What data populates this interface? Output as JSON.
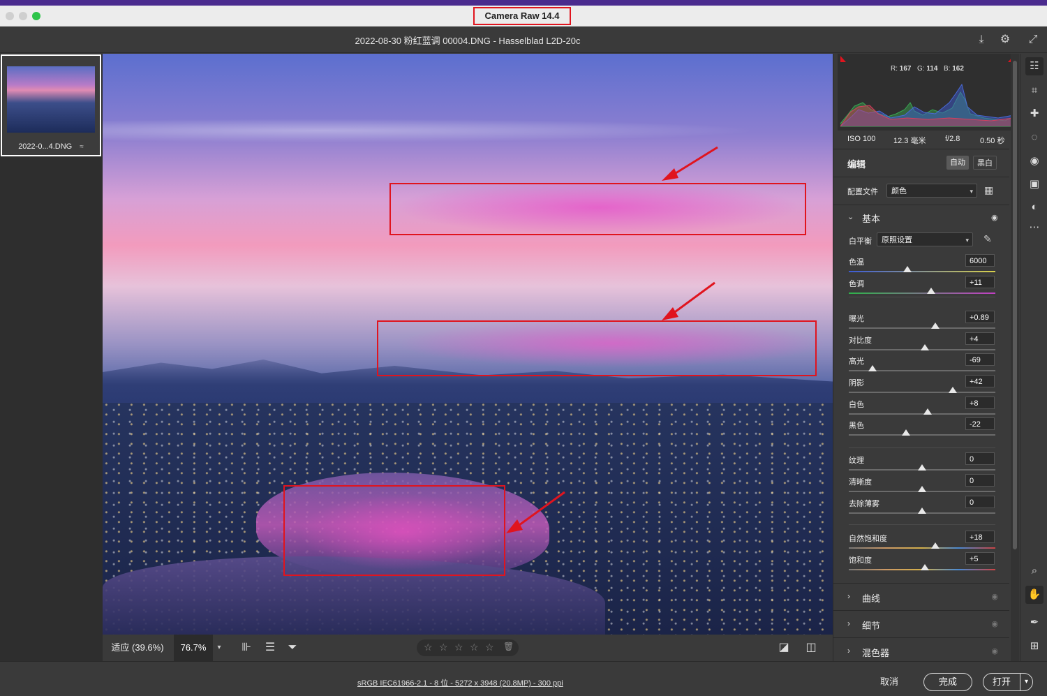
{
  "app": {
    "title": "Camera Raw 14.4",
    "document_title": "2022-08-30 粉红蓝调 00004.DNG -  Hasselblad L2D-20c"
  },
  "filmstrip": {
    "items": [
      {
        "label": "2022-0...4.DNG"
      }
    ]
  },
  "viewer": {
    "zoom_fit_label": "适应 (39.6%)",
    "zoom_value": "76.7%",
    "rating_stars": [
      "☆",
      "☆",
      "☆",
      "☆",
      "☆"
    ]
  },
  "histogram": {
    "r_label": "R:",
    "r": "167",
    "g_label": "G:",
    "g": "114",
    "b_label": "B:",
    "b": "162"
  },
  "exif": {
    "iso": "ISO 100",
    "focal": "12.3 毫米",
    "aperture": "f/2.8",
    "shutter": "0.50 秒"
  },
  "edit": {
    "title": "编辑",
    "auto_label": "自动",
    "bw_label": "黑白",
    "profile_label": "配置文件",
    "profile_value": "颜色"
  },
  "basic": {
    "title": "基本",
    "wb_label": "白平衡",
    "wb_value": "原照设置",
    "sliders": [
      {
        "label": "色温",
        "value": "6000",
        "level": 0.4
      },
      {
        "label": "色调",
        "value": "+11",
        "level": 0.56
      },
      {
        "label": "曝光",
        "value": "+0.89",
        "level": 0.59
      },
      {
        "label": "对比度",
        "value": "+4",
        "level": 0.52
      },
      {
        "label": "高光",
        "value": "-69",
        "level": 0.16
      },
      {
        "label": "阴影",
        "value": "+42",
        "level": 0.71
      },
      {
        "label": "白色",
        "value": "+8",
        "level": 0.54
      },
      {
        "label": "黑色",
        "value": "-22",
        "level": 0.39
      },
      {
        "label": "纹理",
        "value": "0",
        "level": 0.5
      },
      {
        "label": "清晰度",
        "value": "0",
        "level": 0.5
      },
      {
        "label": "去除薄雾",
        "value": "0",
        "level": 0.5
      },
      {
        "label": "自然饱和度",
        "value": "+18",
        "level": 0.59
      },
      {
        "label": "饱和度",
        "value": "+5",
        "level": 0.52
      }
    ]
  },
  "panels": {
    "curves": "曲线",
    "detail": "细节",
    "mixer": "混色器"
  },
  "status": {
    "workflow": "sRGB IEC61966-2.1 - 8 位 - 5272 x 3948 (20.8MP) - 300 ppi"
  },
  "buttons": {
    "cancel": "取消",
    "done": "完成",
    "open": "打开"
  },
  "colors": {
    "accent_red": "#e0141e",
    "menubar": "#4a2b8e",
    "panel_bg": "#3a3a3a"
  }
}
